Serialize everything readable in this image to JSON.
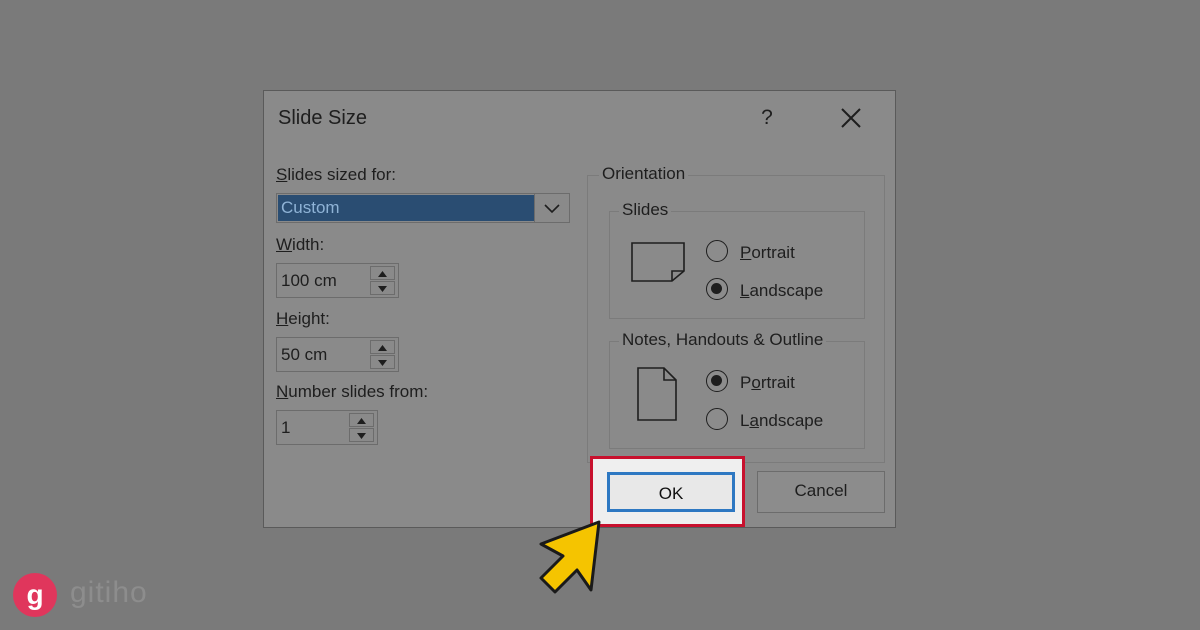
{
  "dialog": {
    "title": "Slide Size",
    "help_label": "?",
    "slides_sized_for": {
      "label_u": "S",
      "label_rest": "lides sized for:",
      "value": "Custom"
    },
    "width": {
      "label_u": "W",
      "label_rest": "idth:",
      "value": "100 cm"
    },
    "height": {
      "label_u": "H",
      "label_rest": "eight:",
      "value": "50 cm"
    },
    "number_slides_from": {
      "label_u": "N",
      "label_rest": "umber slides from:",
      "value": "1"
    },
    "orientation": {
      "legend": "Orientation",
      "slides": {
        "legend": "Slides",
        "portrait_u": "P",
        "portrait_rest": "ortrait",
        "landscape_u": "L",
        "landscape_rest": "andscape",
        "selected": "Landscape"
      },
      "notes": {
        "legend": "Notes, Handouts & Outline",
        "portrait_pre": "P",
        "portrait_u": "o",
        "portrait_rest": "rtrait",
        "landscape_pre": "L",
        "landscape_u": "a",
        "landscape_rest": "ndscape",
        "selected": "Portrait"
      }
    },
    "ok_label": "OK",
    "cancel_label": "Cancel"
  },
  "watermark": {
    "logo_letter": "g",
    "text": "gitiho"
  },
  "colors": {
    "highlight": "#c8112e",
    "ok_focus": "#2e78c2",
    "selection": "#2a4d72",
    "cursor": "#f5c400"
  },
  "icons": [
    "close-icon",
    "chevron-down-icon",
    "spin-up-icon",
    "spin-down-icon",
    "landscape-page-icon",
    "portrait-page-icon",
    "pointer-cursor-icon"
  ]
}
